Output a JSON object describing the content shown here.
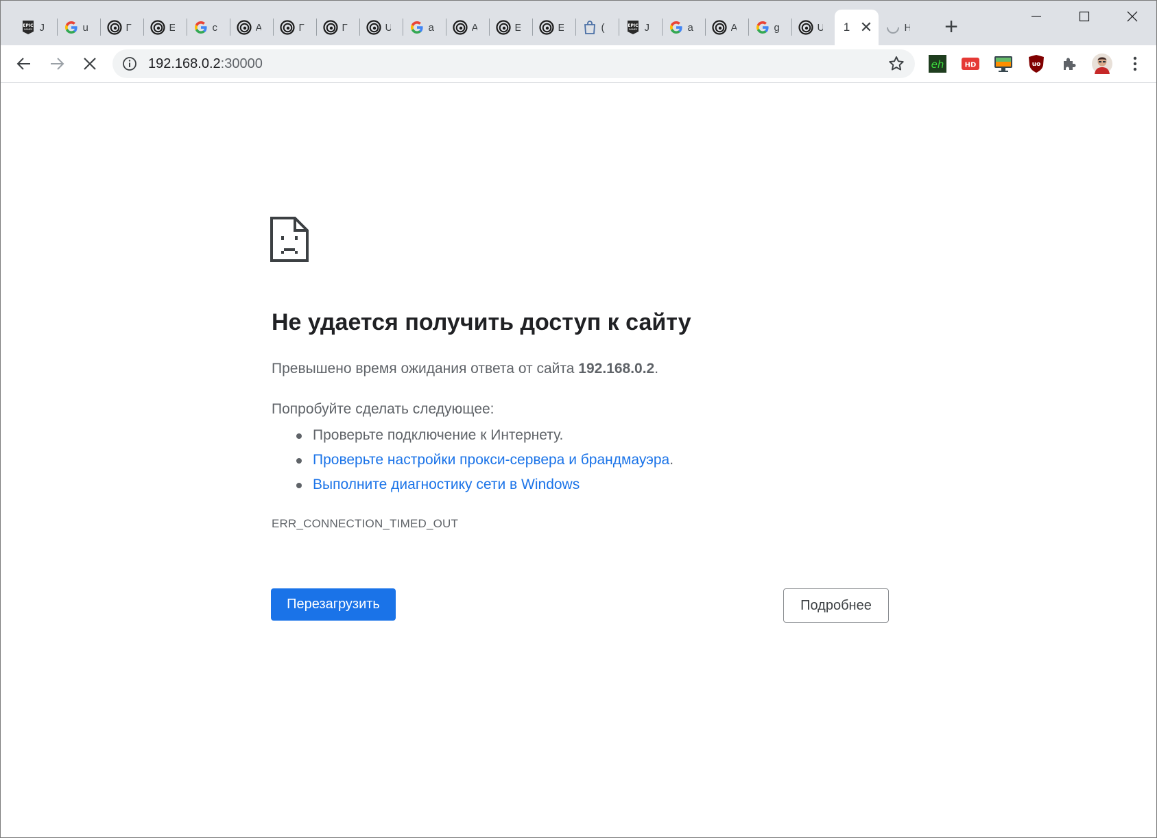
{
  "tabs": [
    {
      "favicon": "epic-games-icon",
      "title_fragment": "J"
    },
    {
      "favicon": "google-icon",
      "title_fragment": "u"
    },
    {
      "favicon": "ubisoft-icon",
      "title_fragment": "Г"
    },
    {
      "favicon": "ubisoft-icon",
      "title_fragment": "E"
    },
    {
      "favicon": "google-icon",
      "title_fragment": "c"
    },
    {
      "favicon": "ubisoft-icon",
      "title_fragment": "A"
    },
    {
      "favicon": "ubisoft-icon",
      "title_fragment": "Г"
    },
    {
      "favicon": "ubisoft-icon",
      "title_fragment": "Г"
    },
    {
      "favicon": "ubisoft-icon",
      "title_fragment": "U"
    },
    {
      "favicon": "google-icon",
      "title_fragment": "a"
    },
    {
      "favicon": "ubisoft-icon",
      "title_fragment": "A"
    },
    {
      "favicon": "ubisoft-icon",
      "title_fragment": "E"
    },
    {
      "favicon": "ubisoft-icon",
      "title_fragment": "E"
    },
    {
      "favicon": "shopping-bag-icon",
      "title_fragment": "("
    },
    {
      "favicon": "epic-games-icon",
      "title_fragment": "J"
    },
    {
      "favicon": "google-icon",
      "title_fragment": "a"
    },
    {
      "favicon": "ubisoft-icon",
      "title_fragment": "A"
    },
    {
      "favicon": "google-icon",
      "title_fragment": "g"
    },
    {
      "favicon": "ubisoft-icon",
      "title_fragment": "U"
    }
  ],
  "active_tab": {
    "title_fragment": "1"
  },
  "loading_tab": {
    "favicon": "loading-spinner-icon",
    "title_fragment": "H"
  },
  "address_bar": {
    "url_host": "192.168.0.2",
    "url_port": ":30000"
  },
  "extensions": [
    {
      "name": "eh-extension-icon",
      "label": "eh"
    },
    {
      "name": "hd-extension-icon",
      "label": "HD"
    },
    {
      "name": "monitor-extension-icon"
    },
    {
      "name": "ublock-origin-icon",
      "label": "uo"
    },
    {
      "name": "extensions-puzzle-icon"
    }
  ],
  "error": {
    "title": "Не удается получить доступ к сайту",
    "description_prefix": "Превышено время ожидания ответа от сайта ",
    "description_host": "192.168.0.2",
    "description_suffix": ".",
    "suggestions_heading": "Попробуйте сделать следующее:",
    "suggestion_1": "Проверьте подключение к Интернету.",
    "suggestion_2_link": "Проверьте настройки прокси-сервера и брандмауэра",
    "suggestion_2_suffix": ".",
    "suggestion_3_link": "Выполните диагностику сети в Windows",
    "error_code": "ERR_CONNECTION_TIMED_OUT",
    "reload_button": "Перезагрузить",
    "details_button": "Подробнее"
  },
  "colors": {
    "tabstrip": "#dee1e6",
    "link": "#1a73e8",
    "primary_button": "#1a73e8",
    "text": "#202124",
    "secondary_text": "#5f6368"
  }
}
